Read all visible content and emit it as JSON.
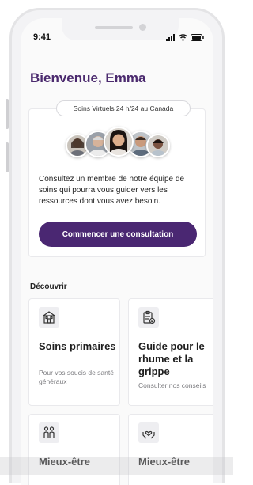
{
  "status_bar": {
    "time": "9:41"
  },
  "welcome": "Bienvenue, Emma",
  "care_card": {
    "badge": "Soins Virtuels 24 h/24 au Canada",
    "description": "Consultez un membre de notre équipe de soins qui pourra vous guider vers les ressources dont vous avez besoin.",
    "cta_label": "Commencer une consultation"
  },
  "discover": {
    "title": "Découvrir",
    "tiles": [
      {
        "icon": "clinic-building-icon",
        "title": "Soins primaires",
        "subtitle": "Pour vos soucis de santé généraux"
      },
      {
        "icon": "clipboard-check-icon",
        "title": "Guide pour le rhume et la grippe",
        "subtitle": "Consulter nos conseils"
      },
      {
        "icon": "people-icon",
        "title": "Mieux-être",
        "subtitle": ""
      },
      {
        "icon": "heart-hands-icon",
        "title": "Mieux-être",
        "subtitle": ""
      }
    ]
  },
  "colors": {
    "brand": "#4a2772",
    "title": "#4b2a6e"
  }
}
